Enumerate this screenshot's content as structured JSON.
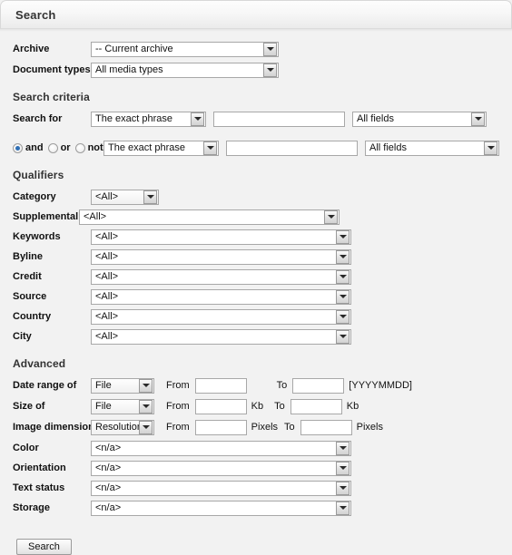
{
  "header": {
    "title": "Search"
  },
  "top": {
    "rows": [
      {
        "label": "Archive",
        "value": "-- Current archive"
      },
      {
        "label": "Document types",
        "value": "All media types"
      }
    ]
  },
  "search_criteria": {
    "title": "Search criteria",
    "row1": {
      "label": "Search for",
      "match_type": "The exact phrase",
      "query": "",
      "query_placeholder": "",
      "field_scope": "All fields"
    },
    "row2": {
      "operators": [
        {
          "label": "and",
          "checked": true
        },
        {
          "label": "or",
          "checked": false
        },
        {
          "label": "not",
          "checked": false
        }
      ],
      "match_type": "The exact phrase",
      "query": "",
      "query_placeholder": "",
      "field_scope": "All fields"
    }
  },
  "qualifiers": {
    "title": "Qualifiers",
    "rows": [
      {
        "label": "Category",
        "value": "<All>",
        "width": "narrow"
      },
      {
        "label": "Supplemental Categories",
        "value": "<All>",
        "width": "wide"
      },
      {
        "label": "Keywords",
        "value": "<All>",
        "width": "wide"
      },
      {
        "label": "Byline",
        "value": "<All>",
        "width": "wide"
      },
      {
        "label": "Credit",
        "value": "<All>",
        "width": "wide"
      },
      {
        "label": "Source",
        "value": "<All>",
        "width": "wide"
      },
      {
        "label": "Country",
        "value": "<All>",
        "width": "wide"
      },
      {
        "label": "City",
        "value": "<All>",
        "width": "wide"
      }
    ]
  },
  "advanced": {
    "title": "Advanced",
    "range_rows": [
      {
        "label": "Date range of",
        "scope": "File",
        "from_label": "From",
        "from_value": "",
        "from_unit": "",
        "to_label": "To",
        "to_value": "",
        "to_unit": "",
        "hint": "[YYYYMMDD]"
      },
      {
        "label": "Size of",
        "scope": "File",
        "from_label": "From",
        "from_value": "",
        "from_unit": "Kb",
        "to_label": "To",
        "to_value": "",
        "to_unit": "Kb",
        "hint": ""
      },
      {
        "label": "Image dimension",
        "scope": "Resolution",
        "from_label": "From",
        "from_value": "",
        "from_unit": "Pixels",
        "to_label": "To",
        "to_value": "",
        "to_unit": "Pixels",
        "hint": ""
      }
    ],
    "select_rows": [
      {
        "label": "Color",
        "value": "<n/a>"
      },
      {
        "label": "Orientation",
        "value": "<n/a>"
      },
      {
        "label": "Text status",
        "value": "<n/a>"
      },
      {
        "label": "Storage",
        "value": "<n/a>"
      }
    ]
  },
  "actions": {
    "submit_label": "Search"
  },
  "colors": {
    "page_background": "#f2f2f2",
    "accent_radio": "#2f6fb5",
    "border": "#a8a8a8",
    "heading_text": "#333333"
  }
}
